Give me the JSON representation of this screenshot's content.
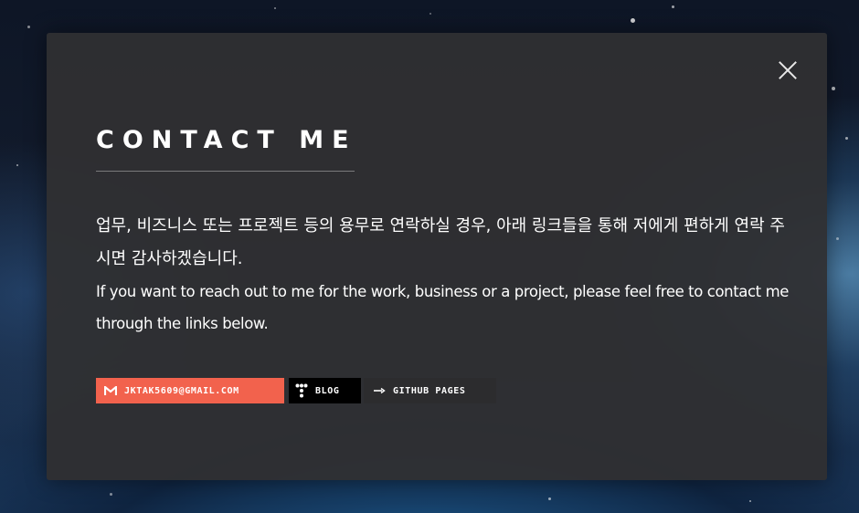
{
  "modal": {
    "title": "CONTACT ME",
    "description_ko": "업무, 비즈니스 또는 프로젝트 등의 용무로 연락하실 경우, 아래 링크들을 통해 저에게 편하게 연락 주시면 감사하겠습니다.",
    "description_en": "If you want to reach out to me for the work, business or a project, please feel free to contact me through the links below."
  },
  "links": {
    "email": {
      "label": "JKTAK5609@GMAIL.COM",
      "icon": "gmail-icon",
      "color": "#f2624d"
    },
    "blog": {
      "label": "BLOG",
      "icon": "tistory-icon",
      "color": "#000000"
    },
    "github": {
      "label": "GITHUB PAGES",
      "icon": "github-pages-icon",
      "color": "#2c2c2e"
    }
  },
  "colors": {
    "overlay": "#303032",
    "text": "#ffffff",
    "divider": "#7a7a7c"
  }
}
